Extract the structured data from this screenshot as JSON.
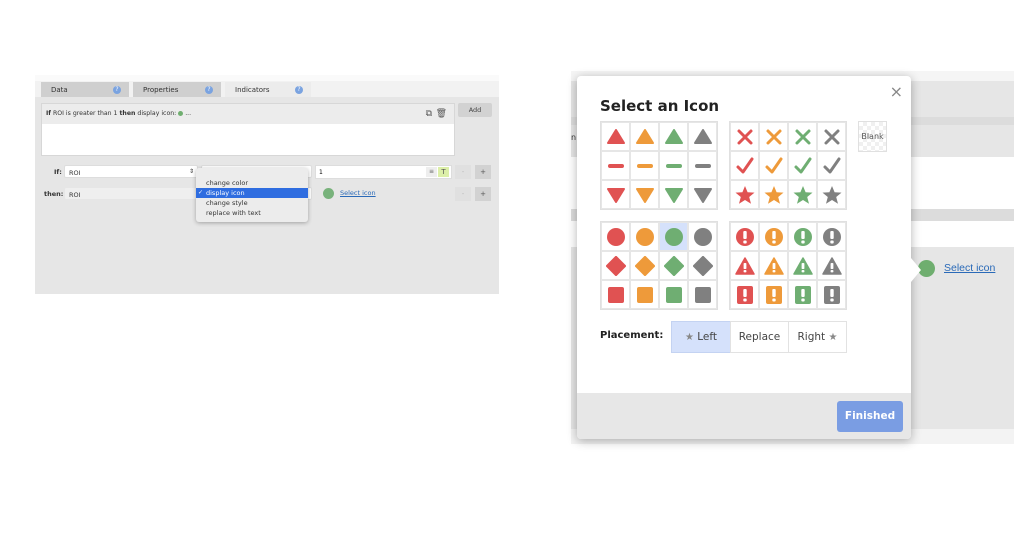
{
  "left_panel": {
    "tabs": [
      {
        "label": "Data",
        "active": false
      },
      {
        "label": "Properties",
        "active": false
      },
      {
        "label": "Indicators",
        "active": true
      }
    ],
    "rule_summary": {
      "if": "If",
      "field": " ROI is greater than 1 ",
      "then": "then",
      "action": " display icon: ",
      "ellipsis": "..."
    },
    "add_label": "Add",
    "if_label": "If:",
    "if_field": "ROI",
    "condition_value": "1",
    "then_label": "then:",
    "then_field": "ROI",
    "select_icon_link": "Select icon",
    "plus_label": "+",
    "minus_label": "-",
    "action_dropdown": {
      "options": [
        "change color",
        "display icon",
        "change style",
        "replace with text"
      ],
      "selected": "display icon"
    },
    "text_toggle_label": "T"
  },
  "background_app": {
    "partial_text": "n",
    "select_icon_link": "Select icon"
  },
  "modal": {
    "title": "Select an Icon",
    "close_label": "×",
    "blank_label": "Blank",
    "colors": {
      "red": "#e05252",
      "orange": "#ee9a3a",
      "green": "#6fae72",
      "gray": "#808080",
      "selected_bg": "#d5e1fb",
      "accent": "#7a9de3"
    },
    "icon_groups": [
      {
        "name": "arrows",
        "rows": [
          "triangle-up",
          "dash",
          "triangle-down"
        ]
      },
      {
        "name": "marks",
        "rows": [
          "x-mark",
          "check",
          "star"
        ]
      },
      {
        "name": "shapes",
        "rows": [
          "circle",
          "diamond",
          "square"
        ]
      },
      {
        "name": "alerts",
        "rows": [
          "exclamation-circle",
          "warning-triangle",
          "exclamation-square"
        ]
      }
    ],
    "selected_icon": "circle-green",
    "placement_label": "Placement:",
    "placement_options": [
      {
        "label": "Left",
        "selected": true
      },
      {
        "label": "Replace",
        "selected": false
      },
      {
        "label": "Right",
        "selected": false
      }
    ],
    "finished_label": "Finished"
  }
}
